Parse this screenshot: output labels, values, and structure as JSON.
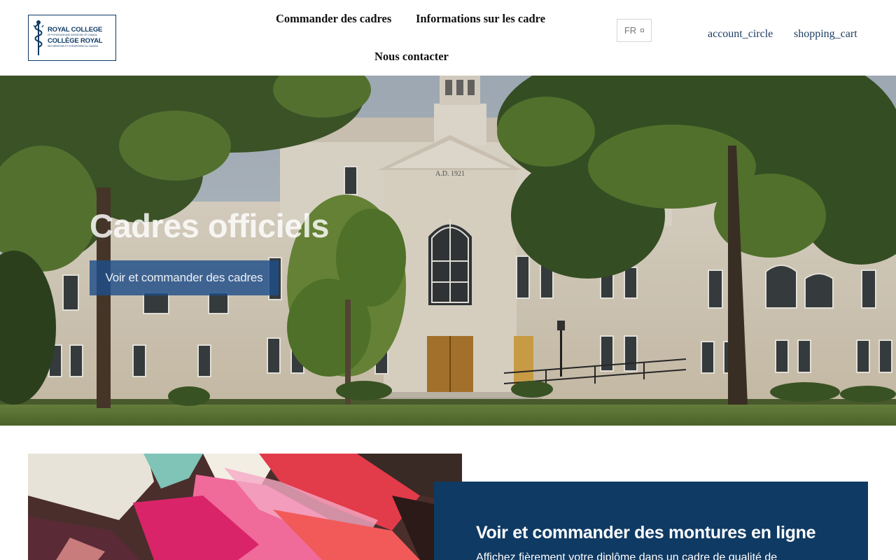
{
  "header": {
    "logo": {
      "line1": "ROYAL COLLEGE",
      "small1": "OF PHYSICIANS AND SURGEONS OF CANADA",
      "line2": "COLLÈGE ROYAL",
      "small2": "DES MÉDECINS ET CHIRURGIENS DU CANADA"
    },
    "nav": {
      "order_frames": "Commander des cadres",
      "frame_info": "Informations sur les cadre",
      "contact": "Nous contacter"
    },
    "language": {
      "selected": "FR"
    },
    "account_icon_text": "account_circle",
    "cart_icon_text": "shopping_cart"
  },
  "hero": {
    "title": "Cadres officiels",
    "cta_label": "Voir et commander des cadres",
    "building_inscription": "A.D. 1921"
  },
  "promo": {
    "title": "Voir et commander des montures en ligne",
    "text": "Affichez fièrement votre diplôme dans un cadre de qualité de"
  },
  "colors": {
    "brand_navy": "#0f3a63",
    "cta_blue": "#1e4e8a"
  }
}
